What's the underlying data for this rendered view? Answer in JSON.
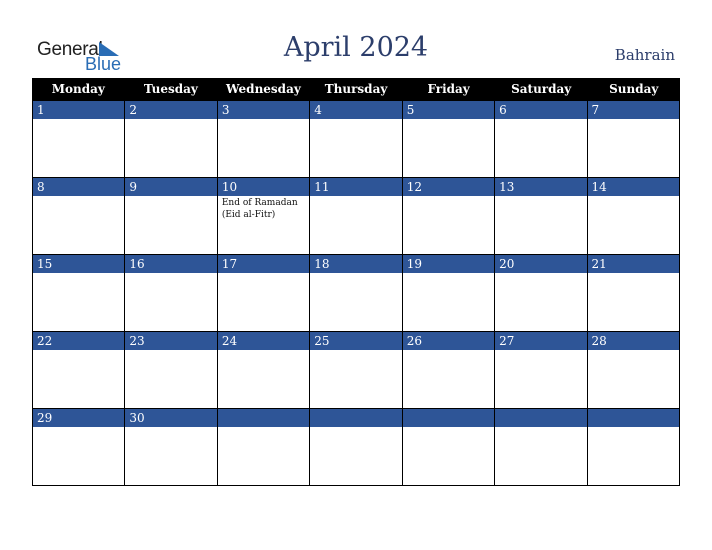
{
  "logo": {
    "word1": "General",
    "word2": "Blue"
  },
  "title": "April 2024",
  "country": "Bahrain",
  "colors": {
    "band": "#2e5597",
    "header": "#000000",
    "title": "#2c3e6b",
    "logo_blue": "#2a6db5"
  },
  "weekdays": [
    "Monday",
    "Tuesday",
    "Wednesday",
    "Thursday",
    "Friday",
    "Saturday",
    "Sunday"
  ],
  "weeks": [
    [
      {
        "day": "1"
      },
      {
        "day": "2"
      },
      {
        "day": "3"
      },
      {
        "day": "4"
      },
      {
        "day": "5"
      },
      {
        "day": "6"
      },
      {
        "day": "7"
      }
    ],
    [
      {
        "day": "8"
      },
      {
        "day": "9"
      },
      {
        "day": "10",
        "event": "End of Ramadan (Eid al-Fitr)"
      },
      {
        "day": "11"
      },
      {
        "day": "12"
      },
      {
        "day": "13"
      },
      {
        "day": "14"
      }
    ],
    [
      {
        "day": "15"
      },
      {
        "day": "16"
      },
      {
        "day": "17"
      },
      {
        "day": "18"
      },
      {
        "day": "19"
      },
      {
        "day": "20"
      },
      {
        "day": "21"
      }
    ],
    [
      {
        "day": "22"
      },
      {
        "day": "23"
      },
      {
        "day": "24"
      },
      {
        "day": "25"
      },
      {
        "day": "26"
      },
      {
        "day": "27"
      },
      {
        "day": "28"
      }
    ],
    [
      {
        "day": "29"
      },
      {
        "day": "30"
      },
      {
        "day": ""
      },
      {
        "day": ""
      },
      {
        "day": ""
      },
      {
        "day": ""
      },
      {
        "day": ""
      }
    ]
  ]
}
